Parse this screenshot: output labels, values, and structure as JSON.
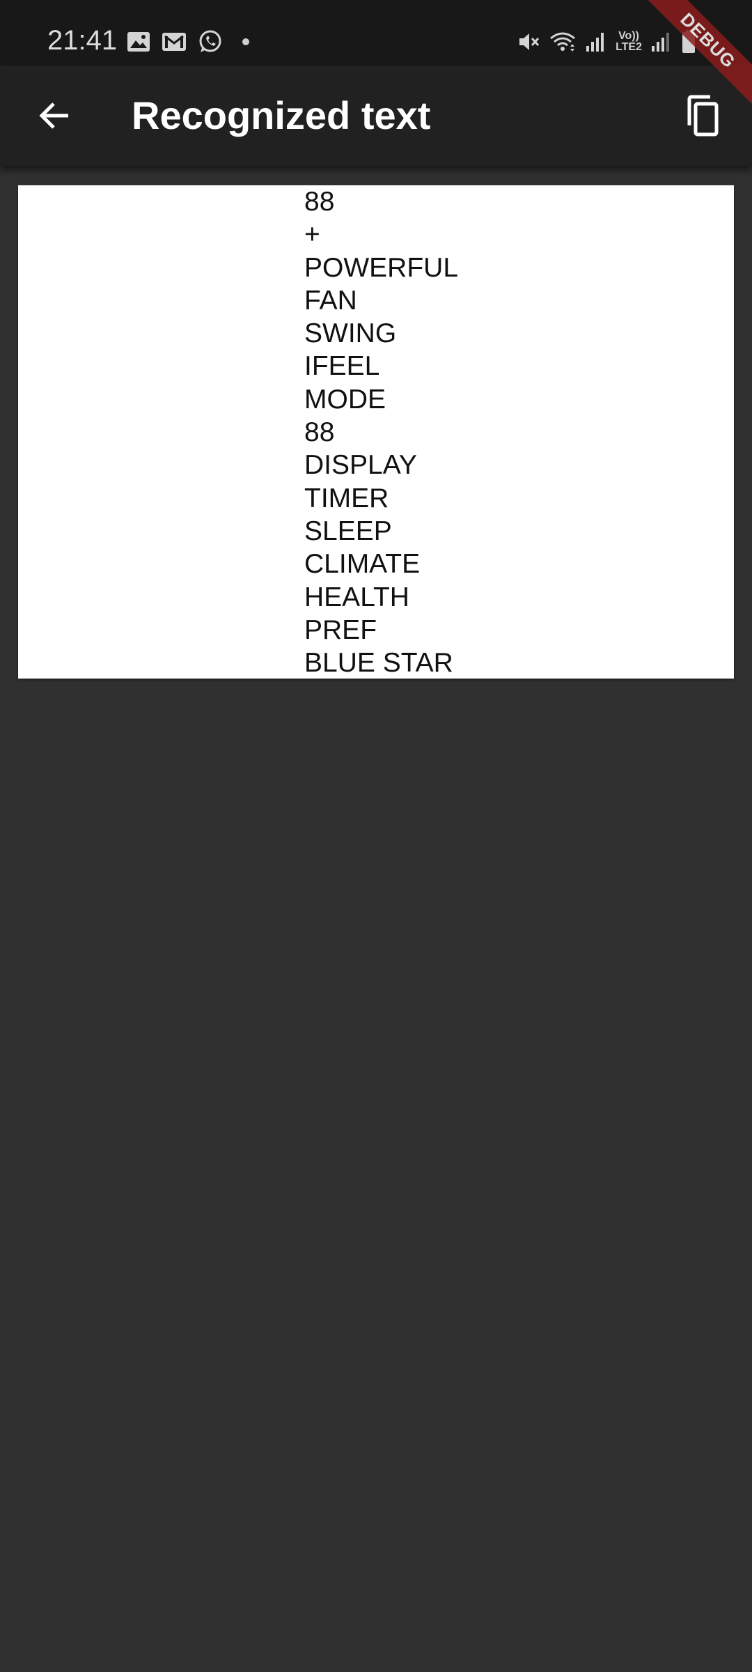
{
  "status_bar": {
    "time": "21:41",
    "left_icons": [
      "gallery-icon",
      "gmail-icon",
      "whatsapp-icon",
      "notification-dot"
    ],
    "right_icons": [
      "mute-icon",
      "wifi-icon",
      "signal-icon",
      "volte-icon",
      "signal-icon-2",
      "battery-icon"
    ],
    "volte_label_top": "Vo))",
    "volte_label_bottom": "LTE2"
  },
  "app_bar": {
    "title": "Recognized text",
    "back_icon": "arrow-back-icon",
    "copy_icon": "copy-icon"
  },
  "debug_banner": {
    "label": "DEBUG",
    "color": "#8b1c1c"
  },
  "recognized_text": {
    "lines": [
      "88",
      "+",
      "POWERFUL",
      "FAN",
      "SWING",
      "IFEEL",
      "MODE",
      "88",
      "DISPLAY",
      "TIMER",
      "SLEEP",
      "CLIMATE",
      "HEALTH",
      "PREF",
      "BLUE STAR"
    ]
  },
  "colors": {
    "background": "#303030",
    "app_bar": "#212121",
    "status_bar": "#181818",
    "card": "#ffffff",
    "text": "#111111"
  }
}
